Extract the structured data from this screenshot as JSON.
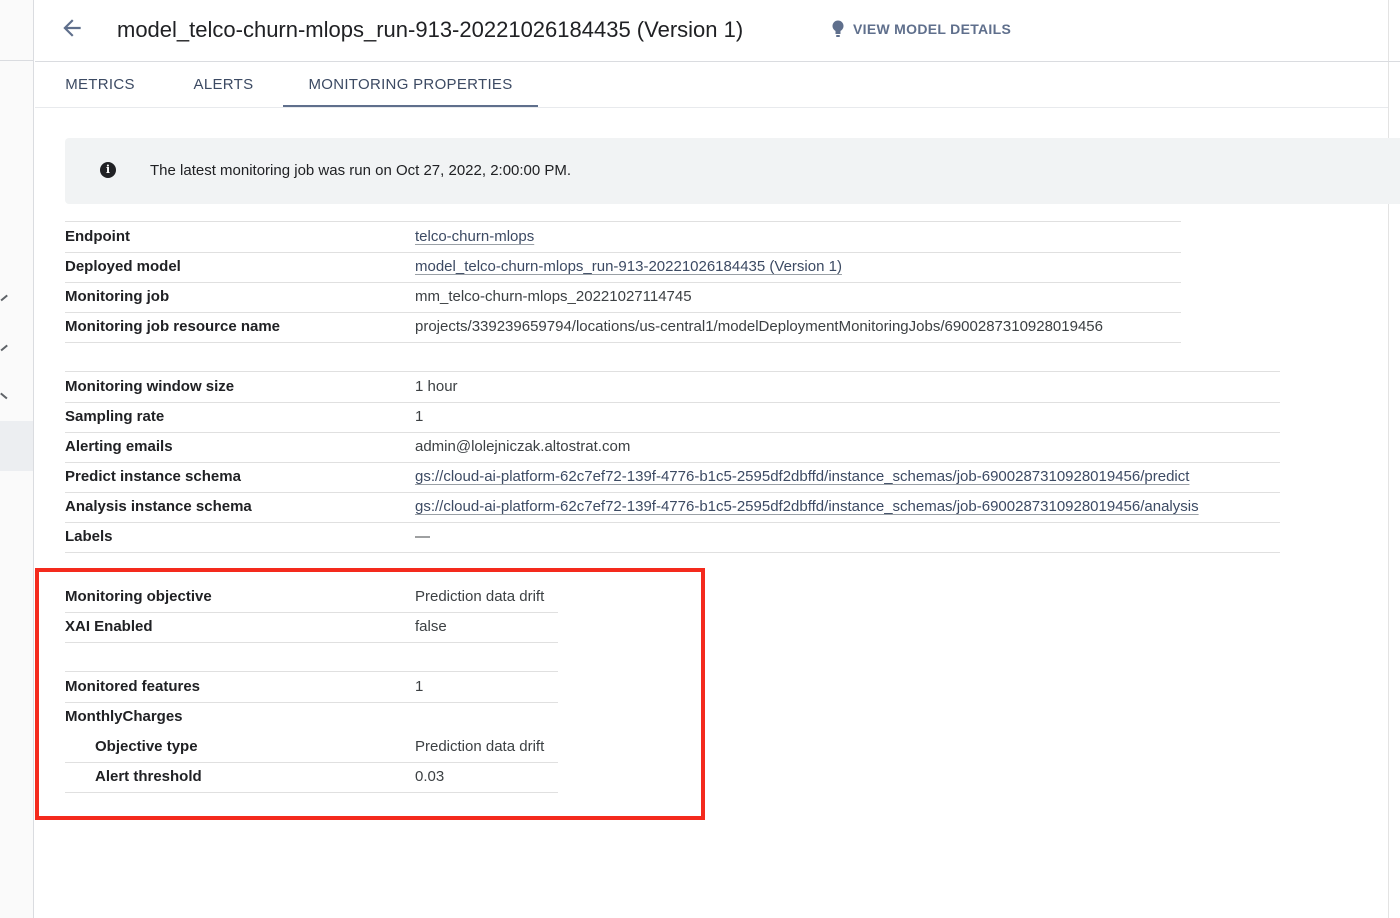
{
  "header": {
    "title": "model_telco-churn-mlops_run-913-20221026184435 (Version 1)",
    "view_details_label": "VIEW MODEL DETAILS"
  },
  "tabs": [
    {
      "label": "METRICS",
      "active": false
    },
    {
      "label": "ALERTS",
      "active": false
    },
    {
      "label": "MONITORING PROPERTIES",
      "active": true
    }
  ],
  "banner": {
    "message": "The latest monitoring job was run on Oct 27, 2022, 2:00:00 PM."
  },
  "section1": [
    {
      "key": "Endpoint",
      "value": "telco-churn-mlops",
      "link": true
    },
    {
      "key": "Deployed model",
      "value": "model_telco-churn-mlops_run-913-20221026184435 (Version 1)",
      "link": true
    },
    {
      "key": "Monitoring job",
      "value": "mm_telco-churn-mlops_20221027114745",
      "link": false
    },
    {
      "key": "Monitoring job resource name",
      "value": "projects/339239659794/locations/us-central1/modelDeploymentMonitoringJobs/6900287310928019456",
      "link": false
    }
  ],
  "section2": [
    {
      "key": "Monitoring window size",
      "value": "1 hour",
      "link": false
    },
    {
      "key": "Sampling rate",
      "value": "1",
      "link": false
    },
    {
      "key": "Alerting emails",
      "value": "admin@lolejniczak.altostrat.com",
      "link": false
    },
    {
      "key": "Predict instance schema",
      "value": "gs://cloud-ai-platform-62c7ef72-139f-4776-b1c5-2595df2dbffd/instance_schemas/job-6900287310928019456/predict",
      "link": true
    },
    {
      "key": "Analysis instance schema",
      "value": "gs://cloud-ai-platform-62c7ef72-139f-4776-b1c5-2595df2dbffd/instance_schemas/job-6900287310928019456/analysis",
      "link": true
    },
    {
      "key": "Labels",
      "value": "—",
      "link": false
    }
  ],
  "section3": [
    {
      "key": "Monitoring objective",
      "value": "Prediction data drift"
    },
    {
      "key": "XAI Enabled",
      "value": "false"
    }
  ],
  "section4": [
    {
      "key": "Monitored features",
      "value": "1"
    },
    {
      "key": "MonthlyCharges",
      "value": ""
    },
    {
      "key": "Objective type",
      "value": "Prediction data drift"
    },
    {
      "key": "Alert threshold",
      "value": "0.03"
    }
  ],
  "colors": {
    "highlight": "#f42a1d",
    "tab_accent": "#5f6f8c",
    "banner_bg": "#f1f3f4"
  },
  "icons": {
    "back": "arrow-back-icon",
    "details": "lightbulb-icon",
    "info": "info-icon"
  }
}
